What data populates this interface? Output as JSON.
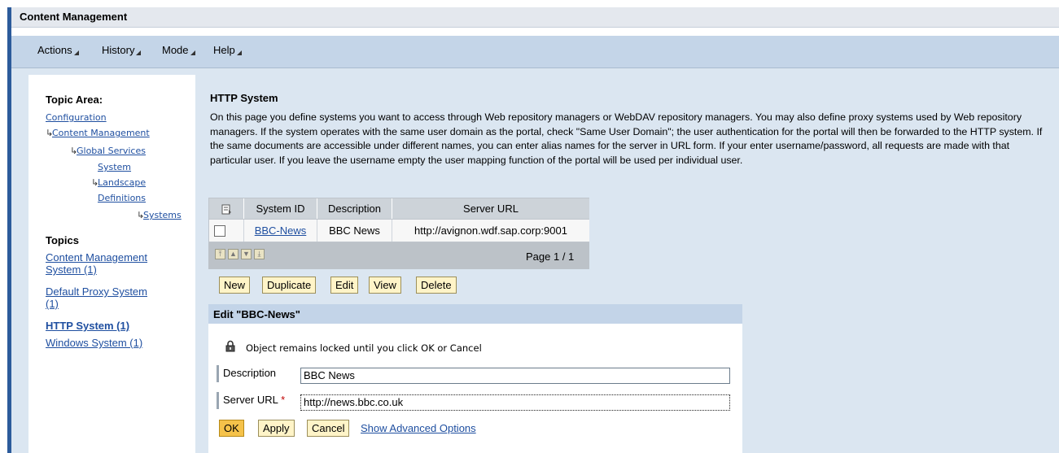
{
  "title": "Content Management",
  "menu": {
    "items": [
      {
        "label": "Actions"
      },
      {
        "label": "History"
      },
      {
        "label": "Mode"
      },
      {
        "label": "Help"
      }
    ]
  },
  "nav": {
    "topic_area_label": "Topic Area:",
    "tree": {
      "configuration": "Configuration",
      "content_management": "Content Management",
      "global_services": "Global Services",
      "system": "System",
      "landscape": "Landscape",
      "definitions": "Definitions",
      "systems": "Systems"
    },
    "topics_label": "Topics",
    "topics": {
      "cms_line1": "Content Management",
      "cms_line2": "System (1)",
      "proxy_line1": "Default Proxy System",
      "proxy_line2": "(1)",
      "http": "HTTP System (1)",
      "windows": "Windows System (1)"
    }
  },
  "content": {
    "title": "HTTP System",
    "description": "On this page you define systems you want to access through Web repository managers or WebDAV repository managers. You may also define proxy systems used by Web repository managers. If the system operates with the same user domain as the portal, check \"Same User Domain\"; the user authentication for the portal will then be forwarded to the HTTP system. If the same documents are accessible under different names, you can enter alias names for the server in URL form. If your enter username/password, all requests are made with that particular user. If you leave the username empty the user mapping function of the portal will be used per individual user."
  },
  "table": {
    "headers": [
      "System ID",
      "Description",
      "Server URL"
    ],
    "rows": [
      {
        "system_id": "BBC-News",
        "description": "BBC News",
        "server_url": "http://avignon.wdf.sap.corp:9001"
      }
    ],
    "pager": "Page 1 / 1"
  },
  "buttons": {
    "new": "New",
    "duplicate": "Duplicate",
    "edit": "Edit",
    "view": "View",
    "delete": "Delete"
  },
  "edit": {
    "title": "Edit \"BBC-News\"",
    "lock_message": "Object remains locked until you click OK or Cancel",
    "description_label": "Description",
    "description_value": "BBC News",
    "server_url_label": "Server URL",
    "required_marker": "*",
    "server_url_value": "http://news.bbc.co.uk",
    "ok": "OK",
    "apply": "Apply",
    "cancel": "Cancel",
    "advanced": "Show Advanced Options"
  }
}
